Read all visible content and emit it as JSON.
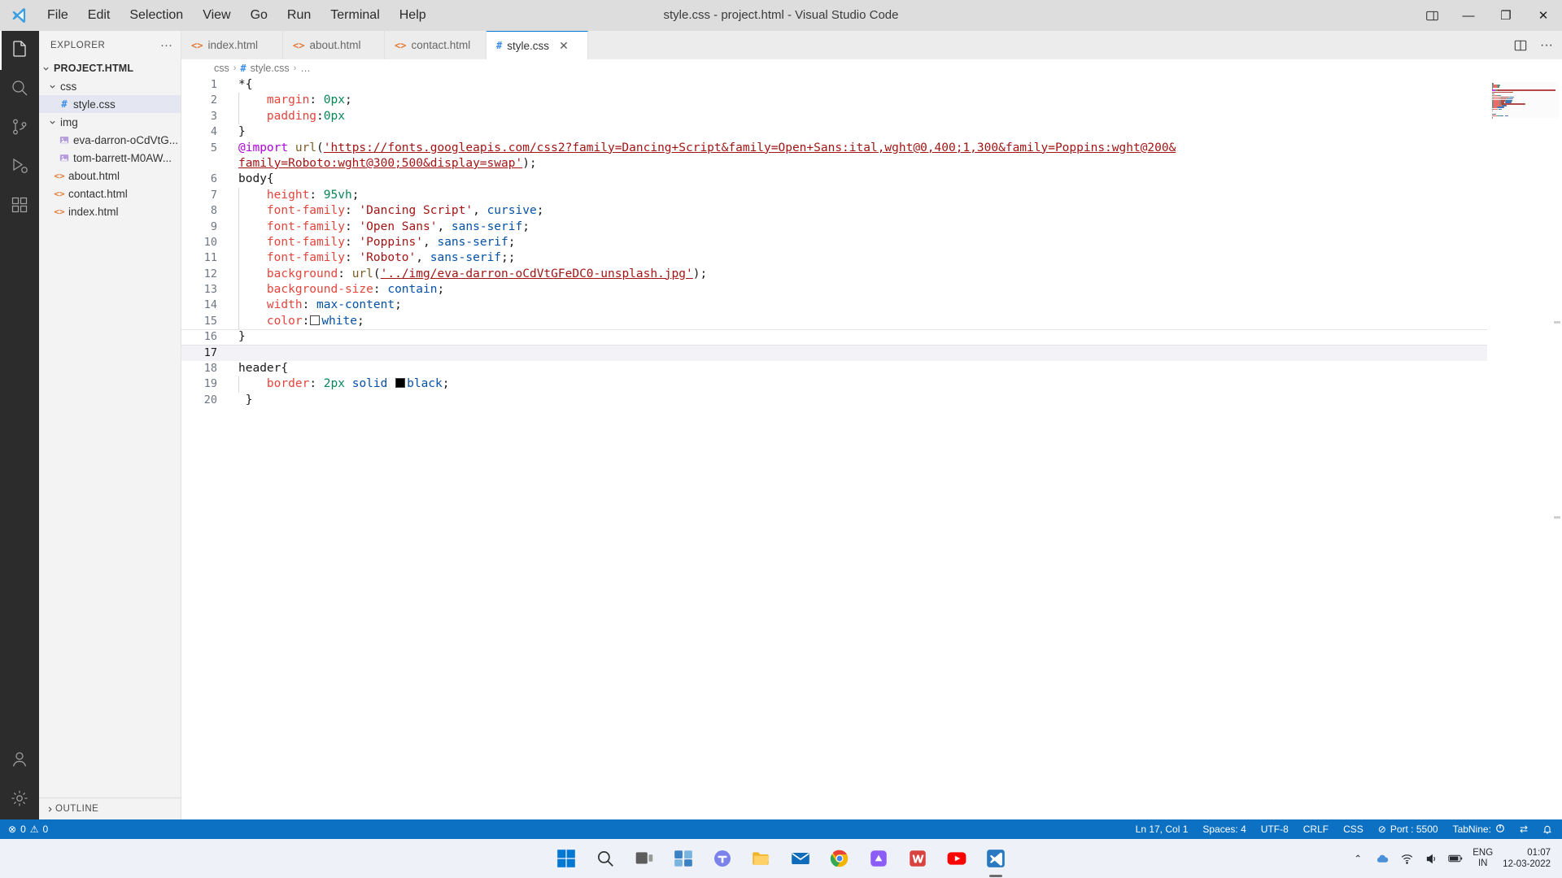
{
  "window": {
    "title": "style.css - project.html - Visual Studio Code",
    "menu": [
      "File",
      "Edit",
      "Selection",
      "View",
      "Go",
      "Run",
      "Terminal",
      "Help"
    ],
    "controls": {
      "minimize": "—",
      "maximize": "❐",
      "close": "✕"
    }
  },
  "activitybar": {
    "items": [
      {
        "name": "explorer",
        "icon": "files-icon"
      },
      {
        "name": "search",
        "icon": "search-icon"
      },
      {
        "name": "source-control",
        "icon": "source-control-icon"
      },
      {
        "name": "run-and-debug",
        "icon": "run-debug-icon"
      },
      {
        "name": "extensions",
        "icon": "extensions-icon"
      },
      {
        "name": "accounts",
        "icon": "account-icon"
      },
      {
        "name": "manage",
        "icon": "gear-icon"
      }
    ]
  },
  "sidebar": {
    "title": "EXPLORER",
    "more_actions": "···",
    "root": "PROJECT.HTML",
    "outline": "OUTLINE",
    "tree": [
      {
        "label": "css",
        "type": "folder",
        "indent": 1,
        "expanded": true,
        "selected": false
      },
      {
        "label": "style.css",
        "type": "css",
        "indent": 3,
        "expanded": false,
        "selected": true
      },
      {
        "label": "img",
        "type": "folder",
        "indent": 1,
        "expanded": true,
        "selected": false
      },
      {
        "label": "eva-darron-oCdVtG...",
        "type": "image",
        "indent": 3,
        "expanded": false,
        "selected": false
      },
      {
        "label": "tom-barrett-M0AW...",
        "type": "image",
        "indent": 3,
        "expanded": false,
        "selected": false
      },
      {
        "label": "about.html",
        "type": "html",
        "indent": 2,
        "expanded": false,
        "selected": false
      },
      {
        "label": "contact.html",
        "type": "html",
        "indent": 2,
        "expanded": false,
        "selected": false
      },
      {
        "label": "index.html",
        "type": "html",
        "indent": 2,
        "expanded": false,
        "selected": false
      }
    ]
  },
  "tabs": [
    {
      "label": "index.html",
      "icon": "html-icon",
      "active": false,
      "closable": false
    },
    {
      "label": "about.html",
      "icon": "html-icon",
      "active": false,
      "closable": false
    },
    {
      "label": "contact.html",
      "icon": "html-icon",
      "active": false,
      "closable": false
    },
    {
      "label": "style.css",
      "icon": "css-icon",
      "active": true,
      "closable": true,
      "close": "✕"
    }
  ],
  "editor_actions": [
    {
      "name": "split-editor-icon"
    },
    {
      "name": "more-actions-icon",
      "glyph": "···"
    }
  ],
  "breadcrumb": {
    "folder": "css",
    "hash": "#",
    "file": "style.css",
    "ellipsis": "…",
    "sep": "›"
  },
  "editor": {
    "lines": [
      {
        "n": 1,
        "tokens": [
          {
            "t": "*",
            "c": "t-sel"
          },
          {
            "t": "{",
            "c": "t-punc"
          }
        ]
      },
      {
        "n": 2,
        "guide": true,
        "tokens": [
          {
            "t": "    ",
            "c": "t-punc"
          },
          {
            "t": "margin",
            "c": "t-prop"
          },
          {
            "t": ": ",
            "c": "t-punc"
          },
          {
            "t": "0px",
            "c": "t-num"
          },
          {
            "t": ";",
            "c": "t-punc"
          }
        ]
      },
      {
        "n": 3,
        "guide": true,
        "tokens": [
          {
            "t": "    ",
            "c": "t-punc"
          },
          {
            "t": "padding",
            "c": "t-prop"
          },
          {
            "t": ":",
            "c": "t-punc"
          },
          {
            "t": "0px",
            "c": "t-num"
          }
        ]
      },
      {
        "n": 4,
        "tokens": [
          {
            "t": "}",
            "c": "t-punc"
          }
        ]
      },
      {
        "n": 5,
        "tokens": [
          {
            "t": "@import",
            "c": "t-at"
          },
          {
            "t": " ",
            "c": "t-punc"
          },
          {
            "t": "url",
            "c": "t-fn"
          },
          {
            "t": "(",
            "c": "t-punc"
          },
          {
            "t": "'https://fonts.googleapis.com/css2?family=Dancing+Script&family=Open+Sans:ital,wght@0,400;1,300&family=Poppins:wght@200&",
            "c": "t-str sq"
          }
        ]
      },
      {
        "n": "",
        "cont": true,
        "tokens": [
          {
            "t": "family=Roboto:wght@300;500&display=swap'",
            "c": "t-str sq"
          },
          {
            "t": ");",
            "c": "t-punc"
          }
        ]
      },
      {
        "n": 6,
        "tokens": [
          {
            "t": "body",
            "c": "t-sel"
          },
          {
            "t": "{",
            "c": "t-punc"
          }
        ]
      },
      {
        "n": 7,
        "guide": true,
        "tokens": [
          {
            "t": "    ",
            "c": "t-punc"
          },
          {
            "t": "height",
            "c": "t-prop"
          },
          {
            "t": ": ",
            "c": "t-punc"
          },
          {
            "t": "95vh",
            "c": "t-num"
          },
          {
            "t": ";",
            "c": "t-punc"
          }
        ]
      },
      {
        "n": 8,
        "guide": true,
        "tokens": [
          {
            "t": "    ",
            "c": "t-punc"
          },
          {
            "t": "font-family",
            "c": "t-prop"
          },
          {
            "t": ": ",
            "c": "t-punc"
          },
          {
            "t": "'Dancing Script'",
            "c": "t-str"
          },
          {
            "t": ", ",
            "c": "t-punc"
          },
          {
            "t": "cursive",
            "c": "t-val2"
          },
          {
            "t": ";",
            "c": "t-punc"
          }
        ]
      },
      {
        "n": 9,
        "guide": true,
        "tokens": [
          {
            "t": "    ",
            "c": "t-punc"
          },
          {
            "t": "font-family",
            "c": "t-prop"
          },
          {
            "t": ": ",
            "c": "t-punc"
          },
          {
            "t": "'Open Sans'",
            "c": "t-str"
          },
          {
            "t": ", ",
            "c": "t-punc"
          },
          {
            "t": "sans-serif",
            "c": "t-val2"
          },
          {
            "t": ";",
            "c": "t-punc"
          }
        ]
      },
      {
        "n": 10,
        "guide": true,
        "tokens": [
          {
            "t": "    ",
            "c": "t-punc"
          },
          {
            "t": "font-family",
            "c": "t-prop"
          },
          {
            "t": ": ",
            "c": "t-punc"
          },
          {
            "t": "'Poppins'",
            "c": "t-str"
          },
          {
            "t": ", ",
            "c": "t-punc"
          },
          {
            "t": "sans-serif",
            "c": "t-val2"
          },
          {
            "t": ";",
            "c": "t-punc"
          }
        ]
      },
      {
        "n": 11,
        "guide": true,
        "tokens": [
          {
            "t": "    ",
            "c": "t-punc"
          },
          {
            "t": "font-family",
            "c": "t-prop"
          },
          {
            "t": ": ",
            "c": "t-punc"
          },
          {
            "t": "'Roboto'",
            "c": "t-str"
          },
          {
            "t": ", ",
            "c": "t-punc"
          },
          {
            "t": "sans-serif",
            "c": "t-val2"
          },
          {
            "t": ";;",
            "c": "t-punc"
          }
        ]
      },
      {
        "n": 12,
        "guide": true,
        "tokens": [
          {
            "t": "    ",
            "c": "t-punc"
          },
          {
            "t": "background",
            "c": "t-prop"
          },
          {
            "t": ": ",
            "c": "t-punc"
          },
          {
            "t": "url",
            "c": "t-fn"
          },
          {
            "t": "(",
            "c": "t-punc"
          },
          {
            "t": "'../img/eva-darron-oCdVtGFeDC0-unsplash.jpg'",
            "c": "t-str sq"
          },
          {
            "t": ");",
            "c": "t-punc"
          }
        ]
      },
      {
        "n": 13,
        "guide": true,
        "tokens": [
          {
            "t": "    ",
            "c": "t-punc"
          },
          {
            "t": "background-size",
            "c": "t-prop"
          },
          {
            "t": ": ",
            "c": "t-punc"
          },
          {
            "t": "contain",
            "c": "t-val2"
          },
          {
            "t": ";",
            "c": "t-punc"
          }
        ]
      },
      {
        "n": 14,
        "guide": true,
        "tokens": [
          {
            "t": "    ",
            "c": "t-punc"
          },
          {
            "t": "width",
            "c": "t-prop"
          },
          {
            "t": ": ",
            "c": "t-punc"
          },
          {
            "t": "max-content",
            "c": "t-val2"
          },
          {
            "t": ";",
            "c": "t-punc"
          }
        ]
      },
      {
        "n": 15,
        "guide": true,
        "tokens": [
          {
            "t": "    ",
            "c": "t-punc"
          },
          {
            "t": "color",
            "c": "t-prop"
          },
          {
            "t": ":",
            "c": "t-punc"
          },
          {
            "t": "__SWATCH_WHITE__",
            "c": "swatch-white"
          },
          {
            "t": "white",
            "c": "t-val2"
          },
          {
            "t": ";",
            "c": "t-punc"
          }
        ]
      },
      {
        "n": 16,
        "tokens": [
          {
            "t": "}",
            "c": "t-punc"
          }
        ]
      },
      {
        "n": 17,
        "current": true,
        "tokens": []
      },
      {
        "n": 18,
        "tokens": [
          {
            "t": "header",
            "c": "t-sel"
          },
          {
            "t": "{",
            "c": "t-punc"
          }
        ]
      },
      {
        "n": 19,
        "guide": true,
        "tokens": [
          {
            "t": "    ",
            "c": "t-punc"
          },
          {
            "t": "border",
            "c": "t-prop"
          },
          {
            "t": ": ",
            "c": "t-punc"
          },
          {
            "t": "2px",
            "c": "t-num"
          },
          {
            "t": " ",
            "c": "t-punc"
          },
          {
            "t": "solid",
            "c": "t-val2"
          },
          {
            "t": " ",
            "c": "t-punc"
          },
          {
            "t": "__SWATCH_BLACK__",
            "c": "swatch-black"
          },
          {
            "t": "black",
            "c": "t-val2"
          },
          {
            "t": ";",
            "c": "t-punc"
          }
        ]
      },
      {
        "n": 20,
        "tokens": [
          {
            "t": " }",
            "c": "t-punc"
          }
        ]
      }
    ]
  },
  "statusbar": {
    "errors": "0",
    "warnings": "0",
    "error_icon": "⊗",
    "warning_icon": "⚠",
    "position": "Ln 17, Col 1",
    "indent": "Spaces: 4",
    "encoding": "UTF-8",
    "eol": "CRLF",
    "language": "CSS",
    "port": "Port : 5500",
    "port_icon": "⊘",
    "tabnine": "TabNine:",
    "bell_icon": "🔔",
    "feedback_icon": "☺",
    "broadcast_icon": "⇄"
  },
  "taskbar": {
    "icons": [
      {
        "name": "start-button",
        "glyph": "windows-icon"
      },
      {
        "name": "search-taskbar",
        "glyph": "search-icon"
      },
      {
        "name": "task-view",
        "glyph": "taskview-icon"
      },
      {
        "name": "widgets",
        "glyph": "widgets-icon"
      },
      {
        "name": "teams",
        "glyph": "teams-icon"
      },
      {
        "name": "file-explorer",
        "glyph": "folder-icon"
      },
      {
        "name": "mail",
        "glyph": "mail-icon"
      },
      {
        "name": "chrome",
        "glyph": "chrome-icon"
      },
      {
        "name": "app-purple",
        "glyph": "app-icon"
      },
      {
        "name": "wps-office",
        "glyph": "wps-icon"
      },
      {
        "name": "youtube",
        "glyph": "youtube-icon"
      },
      {
        "name": "vscode",
        "glyph": "vscode-icon"
      }
    ],
    "tray": {
      "chevron": "⌃",
      "cloud_icon": "☁",
      "network_icon": "wifi-icon",
      "volume_icon": "speaker-icon",
      "battery_icon": "battery-icon"
    },
    "language": {
      "line1": "ENG",
      "line2": "IN"
    },
    "clock": {
      "time": "01:07",
      "date": "12-03-2022"
    }
  },
  "colors": {
    "accent": "#0c71c3",
    "titlebar": "#dddddd",
    "activitybar": "#2c2c2c",
    "sidebar": "#f3f3f3",
    "tabs": "#ececec",
    "editor": "#ffffff",
    "taskbar": "#eef1f7"
  }
}
